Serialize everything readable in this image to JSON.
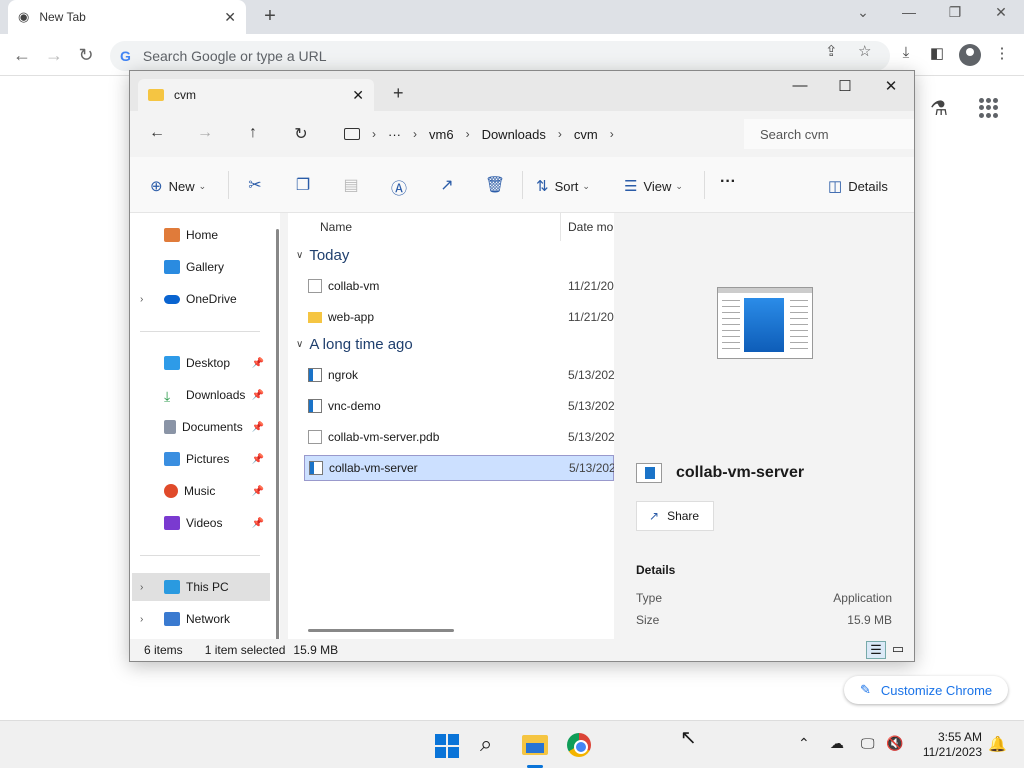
{
  "chrome": {
    "tab_title": "New Tab",
    "omnibox_placeholder": "Search Google or type a URL",
    "customize_label": "Customize Chrome"
  },
  "explorer": {
    "tab_title": "cvm",
    "breadcrumb": [
      "vm6",
      "Downloads",
      "cvm"
    ],
    "search_placeholder": "Search cvm",
    "commands": {
      "new": "New",
      "sort": "Sort",
      "view": "View",
      "details": "Details"
    },
    "sidebar": {
      "quick": [
        {
          "label": "Home"
        },
        {
          "label": "Gallery"
        },
        {
          "label": "OneDrive"
        }
      ],
      "pinned": [
        {
          "label": "Desktop"
        },
        {
          "label": "Downloads"
        },
        {
          "label": "Documents"
        },
        {
          "label": "Pictures"
        },
        {
          "label": "Music"
        },
        {
          "label": "Videos"
        }
      ],
      "devices": [
        {
          "label": "This PC"
        },
        {
          "label": "Network"
        }
      ]
    },
    "columns": {
      "name": "Name",
      "date": "Date mo"
    },
    "groups": {
      "today": "Today",
      "older": "A long time ago"
    },
    "files": {
      "today": [
        {
          "name": "collab-vm",
          "date": "11/21/20"
        },
        {
          "name": "web-app",
          "date": "11/21/20"
        }
      ],
      "older": [
        {
          "name": "ngrok",
          "date": "5/13/202"
        },
        {
          "name": "vnc-demo",
          "date": "5/13/202"
        },
        {
          "name": "collab-vm-server.pdb",
          "date": "5/13/202"
        },
        {
          "name": "collab-vm-server",
          "date": "5/13/202"
        }
      ]
    },
    "preview": {
      "name": "collab-vm-server",
      "share": "Share",
      "details_title": "Details",
      "type_label": "Type",
      "type_value": "Application",
      "size_label": "Size",
      "size_value": "15.9 MB"
    },
    "status": {
      "items": "6 items",
      "selected": "1 item selected",
      "size": "15.9 MB"
    }
  },
  "taskbar": {
    "time": "3:55 AM",
    "date": "11/21/2023"
  }
}
